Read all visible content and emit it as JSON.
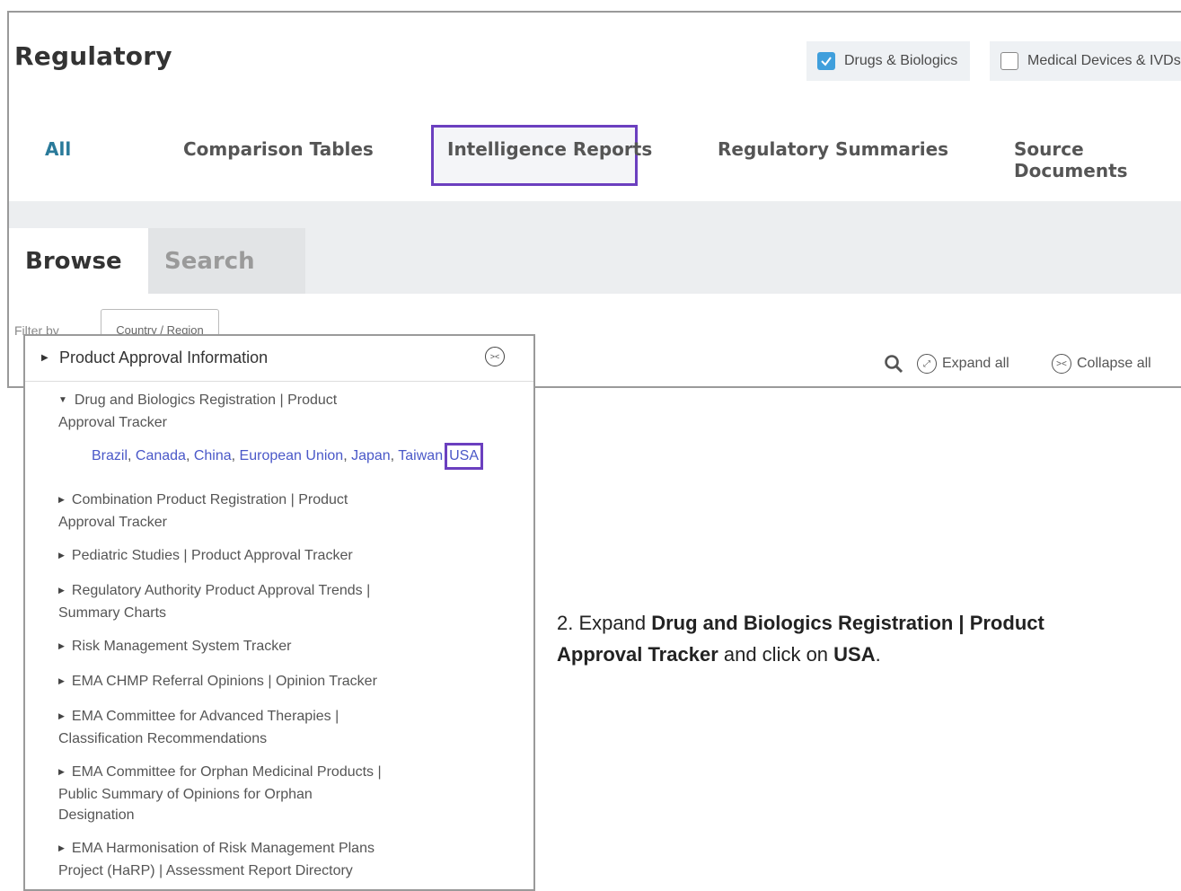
{
  "app_title": "Regulatory",
  "toggles": {
    "drugs_label": "Drugs & Biologics",
    "drugs_checked": true,
    "devices_label": "Medical Devices & IVDs",
    "devices_checked": false
  },
  "nav": [
    "All",
    "Comparison Tables",
    "Intelligence Reports",
    "Regulatory Summaries",
    "Source Documents"
  ],
  "tabs": {
    "browse": "Browse",
    "search": "Search"
  },
  "filter": {
    "label": "Filter by",
    "box": "Country / Region"
  },
  "tools": {
    "expand": "Expand all",
    "collapse": "Collapse all"
  },
  "panel": {
    "title": "Product Approval Information",
    "items": [
      {
        "line1": "Drug and Biologics Registration | Product",
        "line2": "Approval Tracker"
      },
      {
        "line1": "Combination Product Registration | Product",
        "line2": "Approval Tracker"
      },
      {
        "line1": "Pediatric Studies | Product Approval Tracker",
        "line2": ""
      },
      {
        "line1": "Regulatory Authority Product Approval Trends |",
        "line2": "Summary Charts"
      },
      {
        "line1": "Risk Management System Tracker",
        "line2": ""
      },
      {
        "line1": "EMA CHMP Referral Opinions | Opinion Tracker",
        "line2": ""
      },
      {
        "line1": "EMA Committee for Advanced Therapies |",
        "line2": "Classification Recommendations"
      },
      {
        "line1": "EMA Committee for Orphan Medicinal Products |",
        "line2": "Public Summary of Opinions for Orphan",
        "line3": "Designation"
      },
      {
        "line1": "EMA Harmonisation of Risk Management Plans",
        "line2": "Project (HaRP) | Assessment Report Directory"
      }
    ],
    "countries": [
      "Brazil",
      "Canada",
      "China",
      "European Union",
      "Japan",
      "Taiwan"
    ],
    "usa": "USA"
  },
  "note": {
    "prefix": "2.  Expand ",
    "bold1": "Drug and Biologics Registration | Product",
    "bold1b": "Approval Tracker",
    "mid": " and click on ",
    "bold2": "USA",
    "end": "."
  },
  "colors": {
    "highlight": "#6b3fbf",
    "link": "#4a58c8",
    "checked": "#3f9fdc"
  }
}
